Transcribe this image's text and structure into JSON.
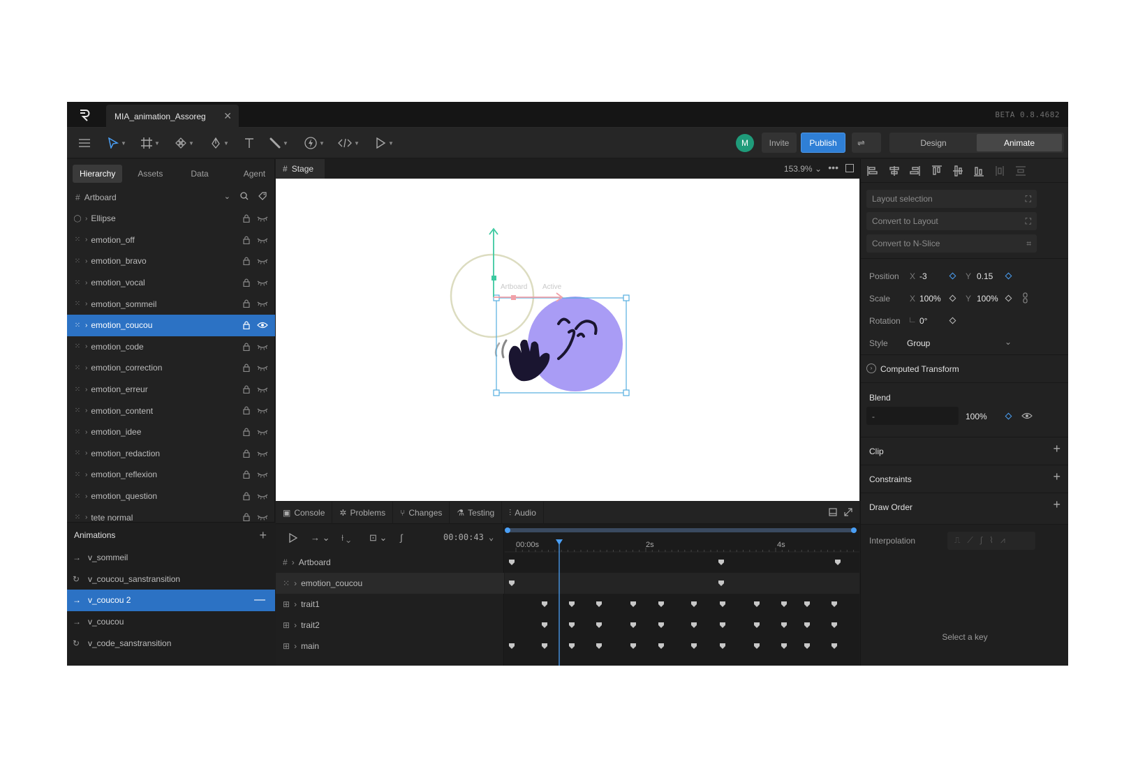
{
  "titlebar": {
    "doc_tab": "MIA_animation_Assoreg",
    "close": "✕",
    "version": "BETA 0.8.4682"
  },
  "toolbar": {
    "avatar_initial": "M",
    "invite": "Invite",
    "publish": "Publish",
    "swap_icon": "⇌",
    "modes": [
      "Design",
      "Animate"
    ],
    "active_mode": "Animate"
  },
  "left_panel": {
    "tabs": [
      "Hierarchy",
      "Assets",
      "Data",
      "Agent"
    ],
    "active_tab": "Hierarchy",
    "root": "Artboard",
    "items": [
      {
        "name": "Ellipse",
        "icon": "ellipse-icon",
        "selected": false
      },
      {
        "name": "emotion_off",
        "icon": "group-icon",
        "selected": false
      },
      {
        "name": "emotion_bravo",
        "icon": "group-icon",
        "selected": false
      },
      {
        "name": "emotion_vocal",
        "icon": "group-icon",
        "selected": false
      },
      {
        "name": "emotion_sommeil",
        "icon": "group-icon",
        "selected": false
      },
      {
        "name": "emotion_coucou",
        "icon": "group-icon",
        "selected": true
      },
      {
        "name": "emotion_code",
        "icon": "group-icon",
        "selected": false
      },
      {
        "name": "emotion_correction",
        "icon": "group-icon",
        "selected": false
      },
      {
        "name": "emotion_erreur",
        "icon": "group-icon",
        "selected": false
      },
      {
        "name": "emotion_content",
        "icon": "group-icon",
        "selected": false
      },
      {
        "name": "emotion_idee",
        "icon": "group-icon",
        "selected": false
      },
      {
        "name": "emotion_redaction",
        "icon": "group-icon",
        "selected": false
      },
      {
        "name": "emotion_reflexion",
        "icon": "group-icon",
        "selected": false
      },
      {
        "name": "emotion_question",
        "icon": "group-icon",
        "selected": false
      },
      {
        "name": "tete normal",
        "icon": "group-icon",
        "selected": false
      }
    ],
    "animations_title": "Animations",
    "animations": [
      {
        "name": "v_sommeil",
        "icon": "→",
        "selected": false
      },
      {
        "name": "v_coucou_sanstransition",
        "icon": "↻",
        "selected": false
      },
      {
        "name": "v_coucou 2",
        "icon": "→",
        "selected": true
      },
      {
        "name": "v_coucou",
        "icon": "→",
        "selected": false
      },
      {
        "name": "v_code_sanstransition",
        "icon": "↻",
        "selected": false
      }
    ]
  },
  "stage": {
    "tab": "Stage",
    "zoom": "153.9%",
    "more": "•••",
    "artboard_label": "Artboard",
    "state_label": "Active"
  },
  "bottom": {
    "tabs": [
      "Console",
      "Problems",
      "Changes",
      "Testing",
      "Audio"
    ],
    "timecode": "00:00:43",
    "ruler": [
      "00:00s",
      "2s",
      "4s"
    ],
    "tracks": [
      {
        "name": "Artboard",
        "icon": "#"
      },
      {
        "name": "emotion_coucou",
        "icon": "⁙"
      },
      {
        "name": "trait1",
        "icon": "⊞"
      },
      {
        "name": "trait2",
        "icon": "⊞"
      },
      {
        "name": "main",
        "icon": "⊞"
      }
    ]
  },
  "right_panel": {
    "layout_selection": "Layout selection",
    "convert_layout": "Convert to Layout",
    "convert_nslice": "Convert to N-Slice",
    "position_label": "Position",
    "position_x": "-3",
    "position_y": "0.15",
    "scale_label": "Scale",
    "scale_x": "100%",
    "scale_y": "100%",
    "rotation_label": "Rotation",
    "rotation": "0°",
    "style_label": "Style",
    "style": "Group",
    "x": "X",
    "y": "Y",
    "computed": "Computed Transform",
    "blend": "Blend",
    "blend_mode": "-",
    "opacity": "100%",
    "clip": "Clip",
    "constraints": "Constraints",
    "draw_order": "Draw Order",
    "interpolation": "Interpolation",
    "select_key": "Select a key"
  },
  "colors": {
    "accent": "#2c72c4",
    "publish": "#2f7fd6",
    "character": "#a99cf5",
    "avatar": "#1f9b7a"
  }
}
